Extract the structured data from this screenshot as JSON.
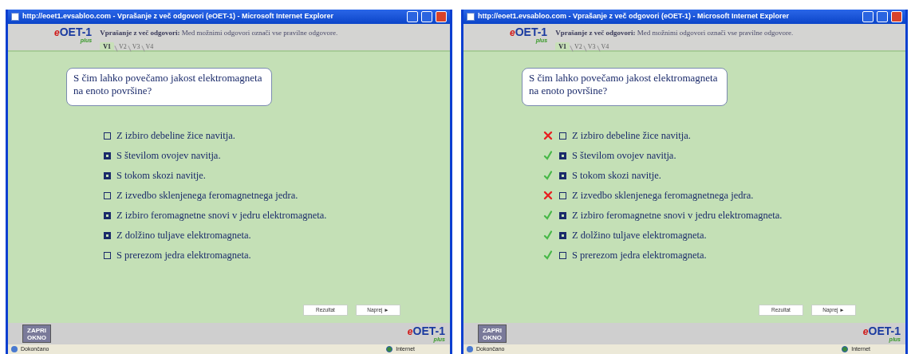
{
  "windows": [
    {
      "title": "http://eoet1.evsabloo.com - Vprašanje z več odgovori (eOET-1) - Microsoft Internet Explorer",
      "logo": {
        "prefix": "e",
        "name": "OET-1",
        "sub": "plus"
      },
      "instruction_label": "Vprašanje z več odgovori:",
      "instruction": "Med možnimi odgovori označi vse pravilne odgovore.",
      "tabs": [
        {
          "label": "V1",
          "selected": true
        },
        {
          "label": "V2",
          "selected": false
        },
        {
          "label": "V3",
          "selected": false
        },
        {
          "label": "V4",
          "selected": false
        }
      ],
      "question": "S čim lahko povečamo jakost elektromagneta na enoto površine?",
      "answers": [
        {
          "text": "Z izbiro debeline žice navitja.",
          "checked": false
        },
        {
          "text": "S številom ovojev navitja.",
          "checked": true
        },
        {
          "text": "S tokom skozi navitje.",
          "checked": true
        },
        {
          "text": "Z izvedbo sklenjenega feromagnetnega jedra.",
          "checked": false
        },
        {
          "text": "Z izbiro feromagnetne snovi v jedru elektromagneta.",
          "checked": true
        },
        {
          "text": "Z dolžino tuljave elektromagneta.",
          "checked": true
        },
        {
          "text": "S prerezom jedra elektromagneta.",
          "checked": false
        }
      ],
      "buttons": [
        "Rezultat",
        "Naprej ►"
      ],
      "close_button": "ZAPRI OKNO",
      "footer_logo": {
        "prefix": "e",
        "name": "OET-1",
        "sub": "plus"
      },
      "status": "Dokončano",
      "zone": "Internet"
    },
    {
      "title": "http://eoet1.evsabloo.com - Vprašanje z več odgovori (eOET-1) - Microsoft Internet Explorer",
      "logo": {
        "prefix": "e",
        "name": "OET-1",
        "sub": "plus"
      },
      "instruction_label": "Vprašanje z več odgovori:",
      "instruction": "Med možnimi odgovori označi vse pravilne odgovore.",
      "tabs": [
        {
          "label": "V1",
          "selected": true
        },
        {
          "label": "V2",
          "selected": false
        },
        {
          "label": "V3",
          "selected": false
        },
        {
          "label": "V4",
          "selected": false
        }
      ],
      "question": "S čim lahko povečamo jakost elektromagneta na enoto površine?",
      "answers": [
        {
          "text": "Z izbiro debeline žice navitja.",
          "checked": false,
          "correct": false
        },
        {
          "text": "S številom ovojev navitja.",
          "checked": true,
          "correct": true
        },
        {
          "text": "S tokom skozi navitje.",
          "checked": true,
          "correct": true
        },
        {
          "text": "Z izvedbo sklenjenega feromagnetnega jedra.",
          "checked": false,
          "correct": false
        },
        {
          "text": "Z izbiro feromagnetne snovi v jedru elektromagneta.",
          "checked": true,
          "correct": true
        },
        {
          "text": "Z dolžino tuljave elektromagneta.",
          "checked": true,
          "correct": true
        },
        {
          "text": "S prerezom jedra elektromagneta.",
          "checked": false,
          "correct": true
        }
      ],
      "buttons": [
        "Rezultat",
        "Naprej ►"
      ],
      "close_button": "ZAPRI OKNO",
      "footer_logo": {
        "prefix": "e",
        "name": "OET-1",
        "sub": "plus"
      },
      "status": "Dokončano",
      "zone": "Internet"
    }
  ]
}
